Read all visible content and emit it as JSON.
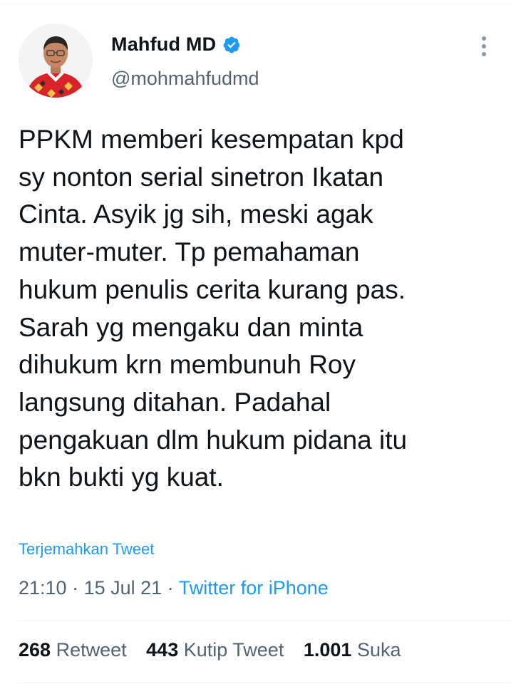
{
  "user": {
    "name": "Mahfud MD",
    "handle": "@mohmahfudmd",
    "verified_icon": "verified-badge-icon",
    "avatar_icon": "profile-photo"
  },
  "more_icon": "more-options-icon",
  "tweet": {
    "text": "PPKM memberi kesempatan kpd\nsy nonton serial sinetron Ikatan\nCinta. Asyik jg sih, meski agak\nmuter-muter. Tp pemahaman\nhukum penulis cerita kurang pas.\nSarah yg mengaku dan minta\ndihukum krn membunuh Roy\nlangsung ditahan. Padahal\npengakuan dlm hukum pidana itu\nbkn bukti yg kuat.",
    "translate_label": "Terjemahkan Tweet",
    "time": "21:10",
    "separator": "·",
    "date": "15 Jul 21",
    "source": "Twitter for iPhone"
  },
  "stats": {
    "retweets_count": "268",
    "retweets_label": "Retweet",
    "quotes_count": "443",
    "quotes_label": "Kutip Tweet",
    "likes_count": "1.001",
    "likes_label": "Suka"
  },
  "colors": {
    "link": "#1d9bf0",
    "secondary_text": "#536471",
    "primary_text": "#0f1419",
    "divider": "#eff3f4"
  }
}
